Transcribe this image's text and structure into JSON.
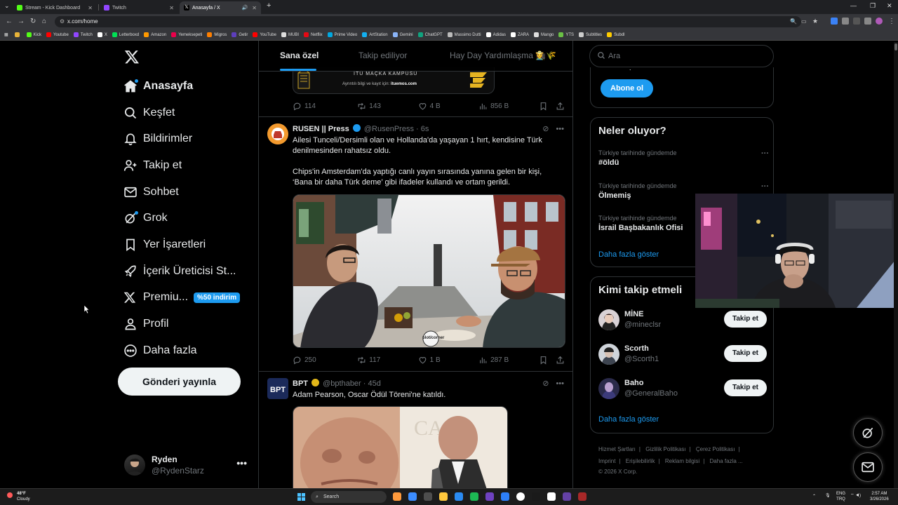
{
  "browser": {
    "tabs": [
      {
        "title": "Stream - Kick Dashboard",
        "color": "#53fc18"
      },
      {
        "title": "Twitch",
        "color": "#9146ff"
      },
      {
        "title": "Anasayfa / X",
        "color": "#ffffff"
      }
    ],
    "new_tab": "+",
    "url": "x.com/home",
    "bookmarks": [
      {
        "label": "Kick",
        "color": "#53fc18"
      },
      {
        "label": "Youtube",
        "color": "#ff0000"
      },
      {
        "label": "Twitch",
        "color": "#9146ff"
      },
      {
        "label": "X",
        "color": "#ffffff"
      },
      {
        "label": "Letterboxd",
        "color": "#00e054"
      },
      {
        "label": "Amazon",
        "color": "#ff9900"
      },
      {
        "label": "Yemeksepeti",
        "color": "#ea004b"
      },
      {
        "label": "Migros",
        "color": "#ff7f00"
      },
      {
        "label": "Getir",
        "color": "#5d3ebc"
      },
      {
        "label": "YouTube",
        "color": "#ff0000"
      },
      {
        "label": "MUBI",
        "color": "#dddddd"
      },
      {
        "label": "Netflix",
        "color": "#e50914"
      },
      {
        "label": "Prime Video",
        "color": "#00a8e1"
      },
      {
        "label": "ArtStation",
        "color": "#13aff0"
      },
      {
        "label": "Gemini",
        "color": "#8ab4f8"
      },
      {
        "label": "ChatGPT",
        "color": "#10a37f"
      },
      {
        "label": "Massimo Dutti",
        "color": "#bbbbbb"
      },
      {
        "label": "Adidas",
        "color": "#ffffff"
      },
      {
        "label": "ZARA",
        "color": "#ffffff"
      },
      {
        "label": "Mango",
        "color": "#dddddd"
      },
      {
        "label": "YTS",
        "color": "#6ac045"
      },
      {
        "label": "Subtitles",
        "color": "#cccccc"
      },
      {
        "label": "Subdl",
        "color": "#ffcc00"
      }
    ]
  },
  "nav": {
    "items": [
      {
        "label": "Anasayfa",
        "icon": "home-icon"
      },
      {
        "label": "Keşfet",
        "icon": "search-icon"
      },
      {
        "label": "Bildirimler",
        "icon": "bell-icon"
      },
      {
        "label": "Takip et",
        "icon": "add-user-icon"
      },
      {
        "label": "Sohbet",
        "icon": "mail-icon"
      },
      {
        "label": "Grok",
        "icon": "grok-icon"
      },
      {
        "label": "Yer İşaretleri",
        "icon": "bookmark-icon"
      },
      {
        "label": "İçerik Üreticisi St...",
        "icon": "rocket-icon"
      },
      {
        "label": "Premiu...",
        "icon": "x-logo-icon",
        "badge": "%50 indirim"
      },
      {
        "label": "Profil",
        "icon": "person-icon"
      },
      {
        "label": "Daha fazla",
        "icon": "more-circle-icon"
      }
    ],
    "post_button": "Gönderi yayınla",
    "user": {
      "name": "Ryden",
      "handle": "@RydenStarz",
      "more": "•••"
    }
  },
  "timeline": {
    "tabs": [
      "Sana özel",
      "Takip ediliyor",
      "Hay Day Yardımlaşma 👩‍🌾🌾"
    ],
    "ad_banner": {
      "line1": "İTÜ MAÇKA KAMPÜSÜ",
      "line2_prefix": "Ayrıntılı bilgi ve kayıt için:",
      "line2_link": "ituemos.com"
    },
    "tweets": [
      {
        "stats": {
          "replies": "114",
          "reposts": "143",
          "likes": "4 B",
          "views": "856 B"
        }
      },
      {
        "name": "RUSEN || Press",
        "handle": "@RusenPress",
        "time": "· 6s",
        "verified_color": "#1d9bf0",
        "text1": "Ailesi Tunceli/Dersimli olan ve Hollanda'da yaşayan 1 hırt, kendisine Türk denilmesinden rahatsız oldu.",
        "text2": "Chips'in Amsterdam'da yaptığı canlı yayın sırasında yanına gelen bir kişi, ‘Bana bir daha Türk deme’ gibi ifadeler kullandı ve ortam gerildi.",
        "stats": {
          "replies": "250",
          "reposts": "117",
          "likes": "1 B",
          "views": "287 B"
        },
        "media_watermark": "plot/corner"
      },
      {
        "name": "BPT",
        "handle": "@bpthaber",
        "time": "· 45d",
        "verified_color": "#e2b719",
        "text1": "Adam Pearson, Oscar Ödül Töreni'ne katıldı."
      }
    ]
  },
  "right": {
    "search_placeholder": "Ara",
    "subscribe_button": "Abone ol",
    "trends_title": "Neler oluyor?",
    "trends": [
      {
        "context": "Türkiye tarihinde gündemde",
        "title": "#öldü"
      },
      {
        "context": "Türkiye tarihinde gündemde",
        "title": "Ölmemiş"
      },
      {
        "context": "Türkiye tarihinde gündemde",
        "title": "İsrail Başbakanlık Ofisi"
      }
    ],
    "trends_more": "Daha fazla göster",
    "who_title": "Kimi takip etmeli",
    "who": [
      {
        "name": "MİNE",
        "handle": "@mineclsr",
        "button": "Takip et"
      },
      {
        "name": "Scorth",
        "handle": "@Scorth1",
        "button": "Takip et"
      },
      {
        "name": "Baho",
        "handle": "@GeneralBaho",
        "button": "Takip et"
      }
    ],
    "who_more": "Daha fazla göster",
    "footer": [
      "Hizmet Şartları",
      "Gizlilik Politikası",
      "Çerez Politikası",
      "Imprint",
      "Erişilebilirlik",
      "Reklam bilgisi",
      "Daha fazla ...",
      "© 2026 X Corp."
    ]
  },
  "taskbar": {
    "weather_temp": "48°F",
    "weather_desc": "Cloudy",
    "search": "Search",
    "lang1": "ENG",
    "lang2": "TRQ",
    "time": "2:57 AM",
    "date": "3/26/2026"
  }
}
